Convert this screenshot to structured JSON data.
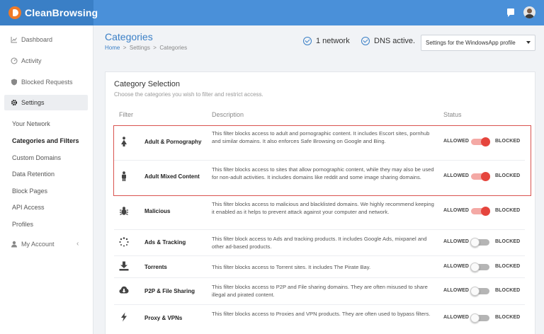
{
  "app": {
    "brand": "CleanBrowsing"
  },
  "sidebar": {
    "main_items": [
      {
        "label": "Dashboard",
        "icon": "chart-icon"
      },
      {
        "label": "Activity",
        "icon": "activity-icon"
      },
      {
        "label": "Blocked Requests",
        "icon": "shield-icon"
      },
      {
        "label": "Settings",
        "icon": "gear-icon"
      }
    ],
    "sub_items": [
      "Your Network",
      "Categories and Filters",
      "Custom Domains",
      "Data Retention",
      "Block Pages",
      "API Access",
      "Profiles"
    ],
    "account": {
      "label": "My Account",
      "chevron": "‹"
    }
  },
  "page": {
    "title": "Categories",
    "breadcrumb": {
      "home": "Home",
      "sep": ">",
      "level2": "Settings",
      "level3": "Categories"
    },
    "status_network": "1 network",
    "status_dns": "DNS active.",
    "profile_select": "Settings for the WindowsApp profile"
  },
  "card": {
    "title": "Category Selection",
    "subtitle": "Choose the categories you wish to filter and restrict access.",
    "headers": {
      "filter": "Filter",
      "description": "Description",
      "status": "Status"
    },
    "allowed_label": "ALLOWED",
    "blocked_label": "BLOCKED",
    "rows": [
      {
        "icon": "adult-icon",
        "name": "Adult & Pornography",
        "enabled": true,
        "description": "This filter blocks access to adult and pornographic content. It includes Escort sites, pornhub and similar domains. It also enforces Safe Browsing on Google and Bing."
      },
      {
        "icon": "person-icon",
        "name": "Adult Mixed Content",
        "enabled": true,
        "description": "This filter blocks access to sites that allow pornographic content, while they may also be used for non-adult activities. It includes domains like reddit and some image sharing domains."
      },
      {
        "icon": "bug-icon",
        "name": "Malicious",
        "enabled": true,
        "description": "This filter blocks access to malicious and blacklisted domains. We highly recommend keeping it enabled as it helps to prevent attack against your computer and network."
      },
      {
        "icon": "spinner-icon",
        "name": "Ads & Tracking",
        "enabled": false,
        "description": "This filter block access to Ads and tracking products. It includes Google Ads, mixpanel and other ad-based products."
      },
      {
        "icon": "download-icon",
        "name": "Torrents",
        "enabled": false,
        "description": "This filter blocks access to Torrent sites. It includes The Pirate Bay."
      },
      {
        "icon": "cloud-download-icon",
        "name": "P2P & File Sharing",
        "enabled": false,
        "description": "This filter blocks access to P2P and File sharing domains. They are often misused to share illegal and pirated content."
      },
      {
        "icon": "bolt-icon",
        "name": "Proxy & VPNs",
        "enabled": false,
        "description": "This filter blocks access to Proxies and VPN products. They are often used to bypass filters."
      }
    ]
  },
  "colors": {
    "header": "#4a90d9",
    "brand_bg": "#3a7fc6",
    "highlight": "#d9534f",
    "toggle_on": "#e5453d"
  }
}
